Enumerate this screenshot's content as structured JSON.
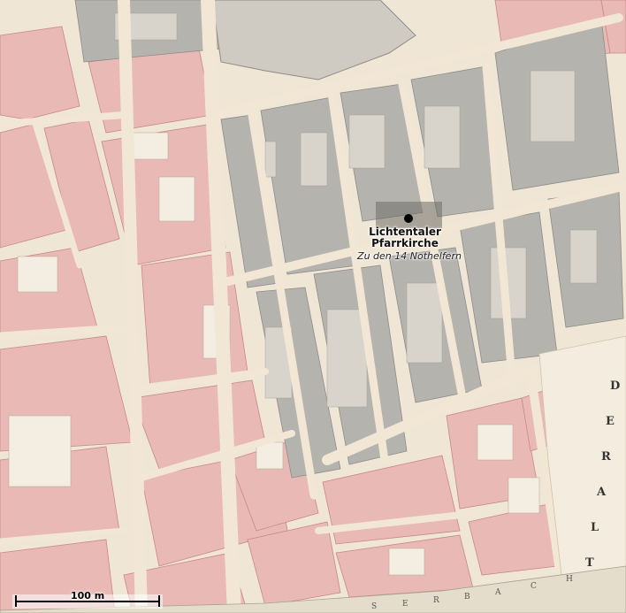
{
  "map": {
    "church": {
      "name_line1": "Lichtentaler",
      "name_line2": "Pfarrkirche",
      "dedication": "Zu den 14 Nothelfern"
    },
    "scale_bar": {
      "label": "100 m"
    },
    "map_lettering": {
      "street_right_vertical": [
        "D",
        "E",
        "R",
        "A",
        "L",
        "T"
      ],
      "bottom_stream": [
        "S",
        "E",
        "R",
        "B",
        "A",
        "C",
        "H"
      ]
    },
    "colors": {
      "paper": "#efe6d6",
      "street": "#f2e7d4",
      "pink_blocks": "#e9b9b6",
      "pink_edge": "#c98886",
      "grey_blocks": "#b5b3ae",
      "grey_edge": "#8e8c88",
      "courtyard": "#f4efe4",
      "church_fill": "#555555"
    }
  }
}
